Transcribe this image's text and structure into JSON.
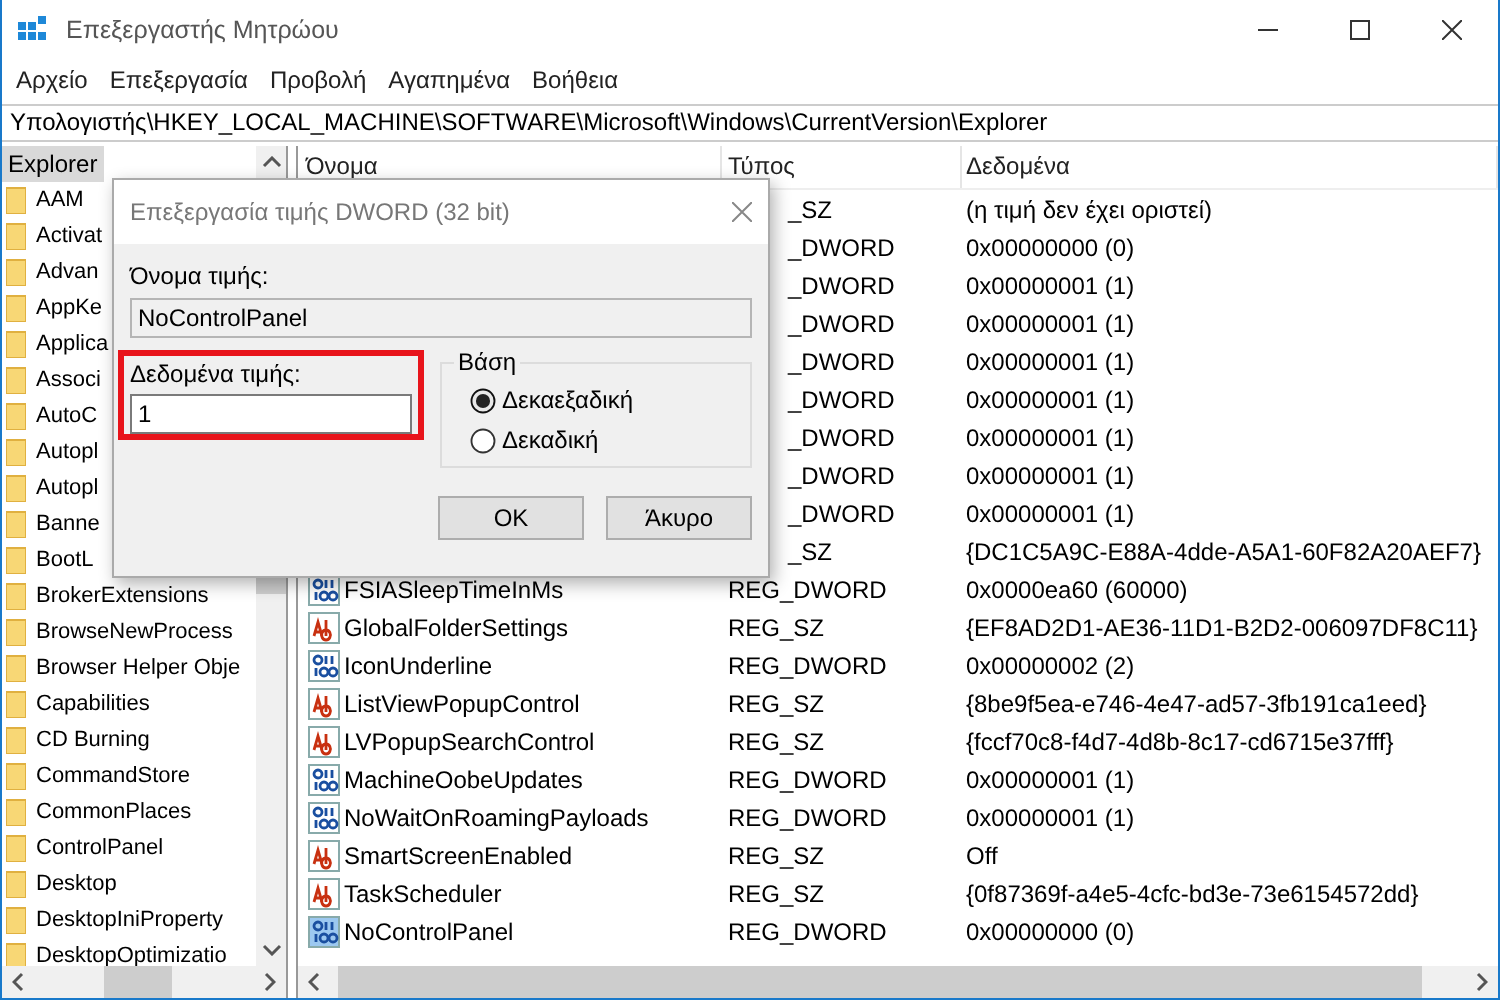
{
  "window": {
    "title": "Επεξεργαστής Μητρώου"
  },
  "menu": [
    "Αρχείο",
    "Επεξεργασία",
    "Προβολή",
    "Αγαπημένα",
    "Βοήθεια"
  ],
  "address": "Υπολογιστής\\HKEY_LOCAL_MACHINE\\SOFTWARE\\Microsoft\\Windows\\CurrentVersion\\Explorer",
  "tree": [
    {
      "label": "Explorer",
      "selected": true,
      "children": [
        {
          "label": "AAM",
          "selected": false
        },
        {
          "label": "Activat",
          "selected": false
        },
        {
          "label": "Advan",
          "selected": false
        },
        {
          "label": "AppKe",
          "selected": false
        },
        {
          "label": "Applica",
          "selected": false
        },
        {
          "label": "Associ",
          "selected": false
        },
        {
          "label": "AutoC",
          "selected": false
        },
        {
          "label": "Autopl",
          "selected": false
        },
        {
          "label": "Autopl",
          "selected": false
        },
        {
          "label": "Banne",
          "selected": false
        },
        {
          "label": "BootL",
          "selected": false
        },
        {
          "label": "BrokerExtensions",
          "selected": false
        },
        {
          "label": "BrowseNewProcess",
          "selected": false
        },
        {
          "label": "Browser Helper Obje",
          "selected": false
        },
        {
          "label": "Capabilities",
          "selected": false
        },
        {
          "label": "CD Burning",
          "selected": false
        },
        {
          "label": "CommandStore",
          "selected": false
        },
        {
          "label": "CommonPlaces",
          "selected": false
        },
        {
          "label": "ControlPanel",
          "selected": false
        },
        {
          "label": "Desktop",
          "selected": false
        },
        {
          "label": "DesktopIniProperty",
          "selected": false
        },
        {
          "label": "DesktopOptimizatio",
          "selected": false
        }
      ]
    }
  ],
  "table": {
    "columns": [
      "Όνομα",
      "Τύπος",
      "Δεδομένα"
    ],
    "rows": [
      {
        "type": "_SZ",
        "data": "(η τιμή δεν έχει οριστεί)"
      },
      {
        "type": "_DWORD",
        "data": "0x00000000 (0)"
      },
      {
        "type": "_DWORD",
        "data": "0x00000001 (1)"
      },
      {
        "type": "_DWORD",
        "data": "0x00000001 (1)"
      },
      {
        "type": "_DWORD",
        "data": "0x00000001 (1)"
      },
      {
        "type": "_DWORD",
        "data": "0x00000001 (1)"
      },
      {
        "type": "_DWORD",
        "data": "0x00000001 (1)"
      },
      {
        "type": "_DWORD",
        "data": "0x00000001 (1)"
      },
      {
        "type": "_DWORD",
        "data": "0x00000001 (1)"
      },
      {
        "type": "_SZ",
        "data": "{DC1C5A9C-E88A-4dde-A5A1-60F82A20AEF7}"
      },
      {
        "kind": "dword",
        "name": "FSIASleepTimeInMs",
        "type": "REG_DWORD",
        "data": "0x0000ea60 (60000)",
        "selected": false
      },
      {
        "kind": "sz",
        "name": "GlobalFolderSettings",
        "type": "REG_SZ",
        "data": "{EF8AD2D1-AE36-11D1-B2D2-006097DF8C11}",
        "selected": false
      },
      {
        "kind": "dword",
        "name": "IconUnderline",
        "type": "REG_DWORD",
        "data": "0x00000002 (2)",
        "selected": false
      },
      {
        "kind": "sz",
        "name": "ListViewPopupControl",
        "type": "REG_SZ",
        "data": "{8be9f5ea-e746-4e47-ad57-3fb191ca1eed}",
        "selected": false
      },
      {
        "kind": "sz",
        "name": "LVPopupSearchControl",
        "type": "REG_SZ",
        "data": "{fccf70c8-f4d7-4d8b-8c17-cd6715e37fff}",
        "selected": false
      },
      {
        "kind": "dword",
        "name": "MachineOobeUpdates",
        "type": "REG_DWORD",
        "data": "0x00000001 (1)",
        "selected": false
      },
      {
        "kind": "dword",
        "name": "NoWaitOnRoamingPayloads",
        "type": "REG_DWORD",
        "data": "0x00000001 (1)",
        "selected": false
      },
      {
        "kind": "sz",
        "name": "SmartScreenEnabled",
        "type": "REG_SZ",
        "data": "Off",
        "selected": false
      },
      {
        "kind": "sz",
        "name": "TaskScheduler",
        "type": "REG_SZ",
        "data": "{0f87369f-a4e5-4cfc-bd3e-73e6154572dd}",
        "selected": false
      },
      {
        "kind": "dword",
        "name": "NoControlPanel",
        "type": "REG_DWORD",
        "data": "0x00000000 (0)",
        "selected": true
      }
    ]
  },
  "dialog": {
    "title": "Επεξεργασία τιμής DWORD (32 bit)",
    "name_label": "Όνομα τιμής:",
    "name_value": "NoControlPanel",
    "data_label": "Δεδομένα τιμής:",
    "data_value": "1",
    "highlight": true,
    "base_label": "Βάση",
    "radios": [
      {
        "label": "Δεκαεξαδική",
        "selected": true
      },
      {
        "label": "Δεκαδική",
        "selected": false
      }
    ],
    "buttons": [
      "OK",
      "Άκυρο"
    ]
  }
}
